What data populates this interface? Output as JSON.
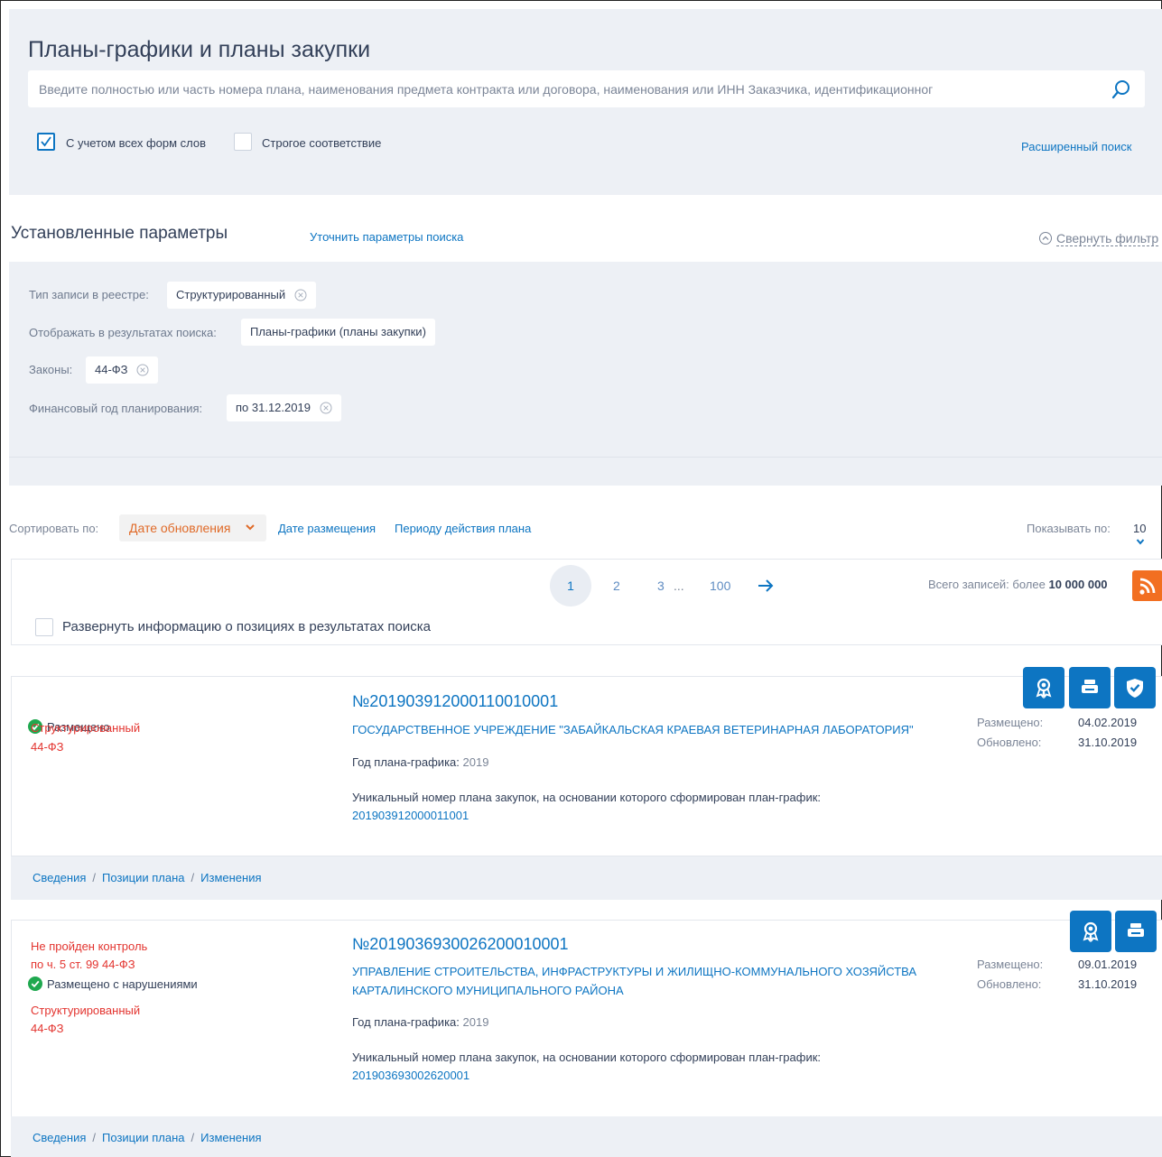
{
  "search": {
    "title": "Планы-графики и планы закупки",
    "placeholder": "Введите полностью или часть номера плана, наименования предмета контракта или договора, наименования или ИНН Заказчика, идентификационног",
    "checkbox_word_forms": "С учетом всех форм слов",
    "checkbox_word_forms_checked": true,
    "checkbox_strict": "Строгое соответствие",
    "checkbox_strict_checked": false,
    "advanced_link": "Расширенный поиск"
  },
  "params": {
    "title": "Установленные параметры",
    "refine_link": "Уточнить параметры поиска",
    "collapse_link": "Свернуть фильтр",
    "items": [
      {
        "label": "Тип записи в реестре:",
        "value": "Структурированный",
        "removable": true
      },
      {
        "label": "Отображать в результатах поиска:",
        "value": "Планы-графики (планы закупки)",
        "removable": false
      },
      {
        "label": "Законы:",
        "value": "44-ФЗ",
        "removable": true
      },
      {
        "label": "Финансовый год планирования:",
        "value": "по 31.12.2019",
        "removable": true
      }
    ]
  },
  "sort": {
    "label": "Сортировать по:",
    "active": "Дате обновления",
    "options": [
      "Дате размещения",
      "Периоду действия плана"
    ],
    "show_label": "Показывать по:",
    "show_value": "10"
  },
  "pager": {
    "current": "1",
    "pages": [
      "2",
      "3",
      "...",
      "100"
    ],
    "total_label": "Всего записей: более",
    "total_value": "10 000 000",
    "expand_label": "Развернуть информацию о позициях в результатах поиска"
  },
  "records": [
    {
      "status_lines": [],
      "status": "Размещено",
      "type": "Структурированный",
      "law": "44-ФЗ",
      "number": "№201903912000110010001",
      "org": "ГОСУДАРСТВЕННОЕ УЧРЕЖДЕНИЕ \"ЗАБАЙКАЛЬСКАЯ КРАЕВАЯ ВЕТЕРИНАРНАЯ ЛАБОРАТОРИЯ\"",
      "year_label": "Год плана-графика:",
      "year": "2019",
      "uid_label": "Уникальный номер плана закупок, на основании которого сформирован план-график:",
      "uid": "201903912000011001",
      "placed_label": "Размещено:",
      "placed": "04.02.2019",
      "updated_label": "Обновлено:",
      "updated": "31.10.2019"
    },
    {
      "status_lines": [
        "Не пройден контроль",
        "по ч. 5 ст. 99 44-ФЗ"
      ],
      "status": "Размещено с нарушениями",
      "type": "Структурированный",
      "law": "44-ФЗ",
      "number": "№201903693002620001 0001",
      "org_line1": "УПРАВЛЕНИЕ СТРОИТЕЛЬСТВА, ИНФРАСТРУКТУРЫ И ЖИЛИЩНО-КОММУНАЛЬНОГО ХОЗЯЙСТВА",
      "org_line2": "КАРТАЛИНСКОГО МУНИЦИПАЛЬНОГО РАЙОНА",
      "year_label": "Год плана-графика:",
      "year": "2019",
      "uid_label": "Уникальный номер плана закупок, на основании которого сформирован план-график:",
      "uid": "201903693002620001",
      "placed_label": "Размещено:",
      "placed": "09.01.2019",
      "updated_label": "Обновлено:",
      "updated": "31.10.2019"
    }
  ],
  "footer_links": [
    "Сведения",
    "Позиции плана",
    "Изменения"
  ],
  "colors": {
    "accent": "#0d75c2",
    "orange": "#e06a28",
    "error": "#e3342f",
    "success": "#1fa84f",
    "panel": "#edf0f5"
  }
}
